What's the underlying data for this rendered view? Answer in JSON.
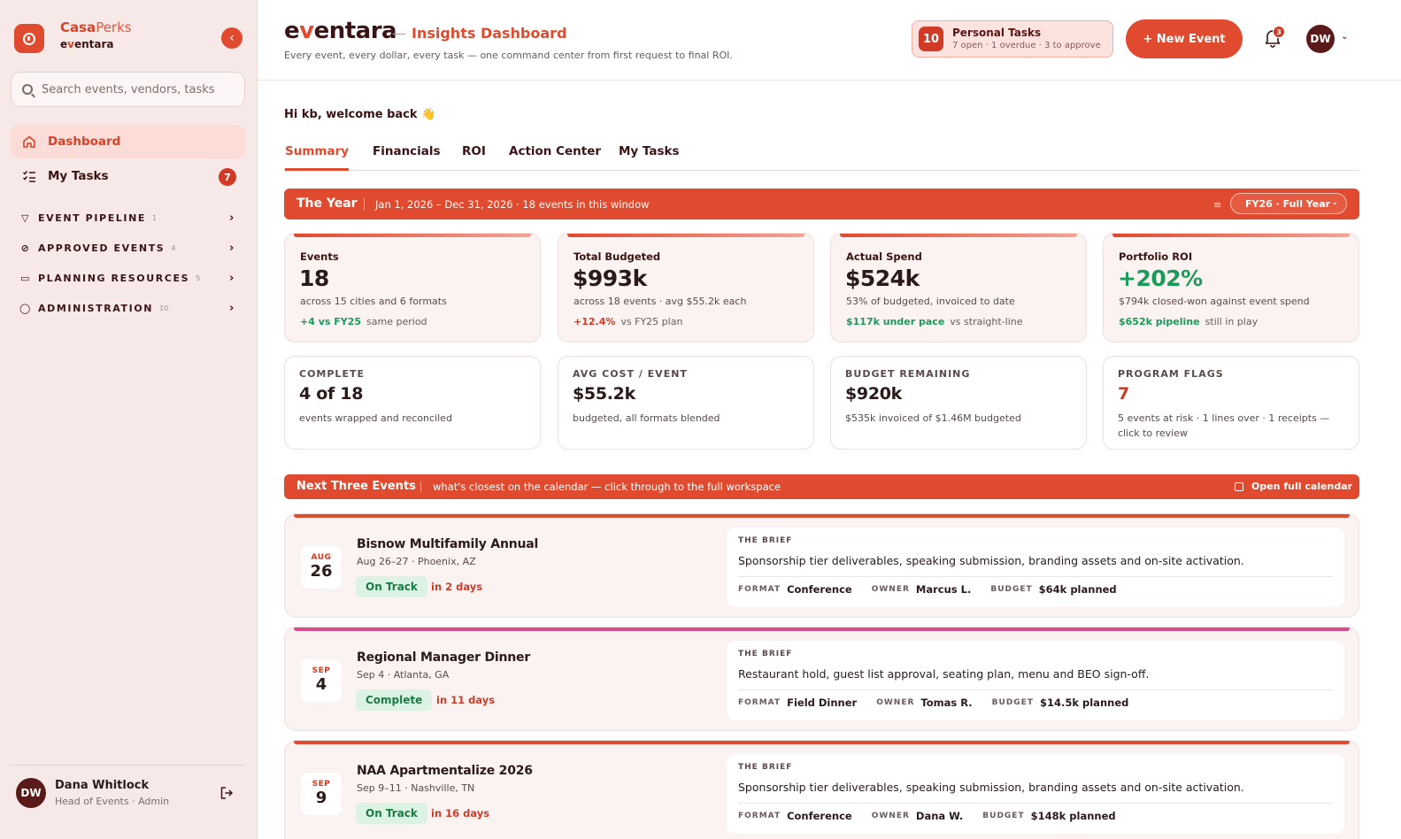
{
  "brand": {
    "name_bold": "Casa",
    "name_light": "Perks",
    "sub_prefix": "e",
    "sub_v": "v",
    "sub_suffix": "entara"
  },
  "search": {
    "placeholder": "Search events, vendors, tasks"
  },
  "nav": {
    "dashboard": "Dashboard",
    "my_tasks": "My Tasks",
    "my_tasks_count": "7"
  },
  "sections": [
    {
      "label": "EVENT PIPELINE",
      "count": "1"
    },
    {
      "label": "APPROVED EVENTS",
      "count": "4"
    },
    {
      "label": "PLANNING RESOURCES",
      "count": "5"
    },
    {
      "label": "ADMINISTRATION",
      "count": "10"
    }
  ],
  "user": {
    "initials": "DW",
    "name": "Dana Whitlock",
    "role": "Head of Events · Admin"
  },
  "header": {
    "logo_e": "e",
    "logo_v": "v",
    "logo_rest": "entara",
    "dash": "—",
    "title": "Insights Dashboard",
    "tagline": "Every event, every dollar, every task — one command center from first request to final ROI.",
    "tasks_count": "10",
    "tasks_title": "Personal Tasks",
    "tasks_sub": "7 open · 1 overdue · 3 to approve",
    "new_event": "+ New Event",
    "bell_count": "3",
    "avatar": "DW"
  },
  "welcome": "Hi kb, welcome back 👋",
  "tabs": [
    "Summary",
    "Financials",
    "ROI",
    "Action Center",
    "My Tasks"
  ],
  "year_bar": {
    "title": "The Year",
    "subtitle": "Jan 1, 2026 – Dec 31, 2026 · 18 events in this window",
    "select": "FY26 · Full Year"
  },
  "kpis": [
    {
      "label": "Events",
      "value": "18",
      "sub": "across 15 cities and 6 formats",
      "delta": "+4 vs FY25",
      "note": "same period",
      "tone": "green"
    },
    {
      "label": "Total Budgeted",
      "value": "$993k",
      "sub": "across 18 events · avg $55.2k each",
      "delta": "+12.4%",
      "note": "vs FY25 plan",
      "tone": "red"
    },
    {
      "label": "Actual Spend",
      "value": "$524k",
      "sub": "53% of budgeted, invoiced to date",
      "delta": "$117k under pace",
      "note": "vs straight-line",
      "tone": "green"
    },
    {
      "label": "Portfolio ROI",
      "value": "+202%",
      "sub": "$794k closed-won against event spend",
      "delta": "$652k pipeline",
      "note": "still in play",
      "tone": "green"
    }
  ],
  "stats": [
    {
      "label": "COMPLETE",
      "value": "4 of 18",
      "sub": "events wrapped and reconciled"
    },
    {
      "label": "AVG COST / EVENT",
      "value": "$55.2k",
      "sub": "budgeted, all formats blended"
    },
    {
      "label": "BUDGET REMAINING",
      "value": "$920k",
      "sub": "$535k invoiced of $1.46M budgeted"
    },
    {
      "label": "PROGRAM FLAGS",
      "value": "7",
      "sub": "5 events at risk · 1 lines over · 1 receipts — click to review"
    }
  ],
  "next_bar": {
    "title": "Next Three Events",
    "subtitle": "what's closest on the calendar — click through to the full workspace",
    "link": "Open full calendar"
  },
  "events": [
    {
      "month": "AUG",
      "day": "26",
      "title": "Bisnow Multifamily Annual",
      "meta": "Aug 26–27 · Phoenix, AZ",
      "status": "On Track",
      "when": "in 2 days",
      "brief_label": "THE BRIEF",
      "brief": "Sponsorship tier deliverables, speaking submission, branding assets and on-site activation.",
      "format_k": "FORMAT",
      "format": "Conference",
      "owner_k": "OWNER",
      "owner": "Marcus L.",
      "budget_k": "BUDGET",
      "budget": "$64k planned",
      "accent": "#e04a2e"
    },
    {
      "month": "SEP",
      "day": "4",
      "title": "Regional Manager Dinner",
      "meta": "Sep 4 · Atlanta, GA",
      "status": "Complete",
      "when": "in 11 days",
      "brief_label": "THE BRIEF",
      "brief": "Restaurant hold, guest list approval, seating plan, menu and BEO sign-off.",
      "format_k": "FORMAT",
      "format": "Field Dinner",
      "owner_k": "OWNER",
      "owner": "Tomas R.",
      "budget_k": "BUDGET",
      "budget": "$14.5k planned",
      "accent": "#d94a8c"
    },
    {
      "month": "SEP",
      "day": "9",
      "title": "NAA Apartmentalize 2026",
      "meta": "Sep 9–11 · Nashville, TN",
      "status": "On Track",
      "when": "in 16 days",
      "brief_label": "THE BRIEF",
      "brief": "Sponsorship tier deliverables, speaking submission, branding assets and on-site activation.",
      "format_k": "FORMAT",
      "format": "Conference",
      "owner_k": "OWNER",
      "owner": "Dana W.",
      "budget_k": "BUDGET",
      "budget": "$148k planned",
      "accent": "#e04a2e"
    }
  ]
}
